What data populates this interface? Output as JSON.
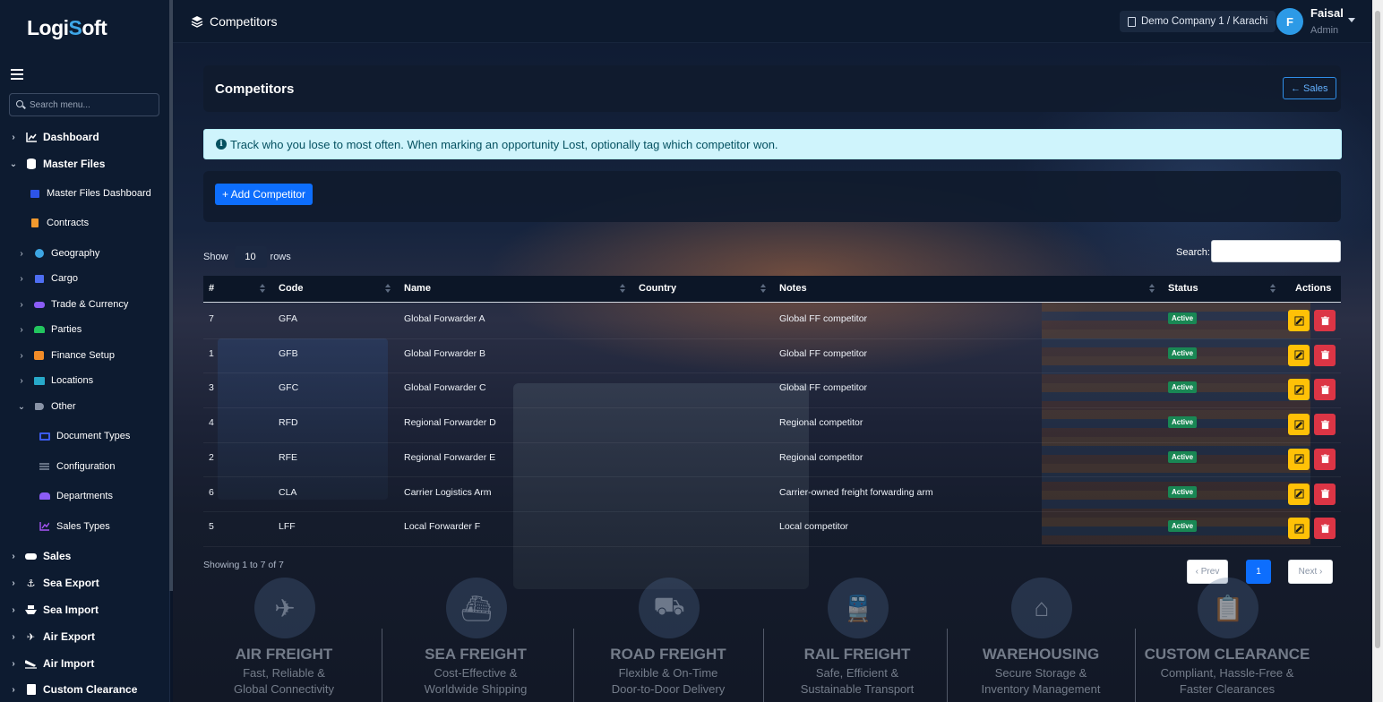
{
  "app": {
    "logo_pre": "Logi",
    "logo_o": "S",
    "logo_post": "oft"
  },
  "sidebar": {
    "search_placeholder": "Search menu...",
    "items": [
      {
        "label": "Dashboard"
      },
      {
        "label": "Master Files"
      },
      {
        "label": "Master Files Dashboard"
      },
      {
        "label": "Contracts"
      },
      {
        "label": "Geography"
      },
      {
        "label": "Cargo"
      },
      {
        "label": "Trade & Currency"
      },
      {
        "label": "Parties"
      },
      {
        "label": "Finance Setup"
      },
      {
        "label": "Locations"
      },
      {
        "label": "Other"
      },
      {
        "label": "Document Types"
      },
      {
        "label": "Configuration"
      },
      {
        "label": "Departments"
      },
      {
        "label": "Sales Types"
      },
      {
        "label": "Sales"
      },
      {
        "label": "Sea Export"
      },
      {
        "label": "Sea Import"
      },
      {
        "label": "Air Export"
      },
      {
        "label": "Air Import"
      },
      {
        "label": "Custom Clearance"
      }
    ]
  },
  "header": {
    "title": "Competitors",
    "company": "Demo Company 1 / Karachi",
    "user_initial": "F",
    "user_name": "Faisal",
    "user_role": "Admin"
  },
  "page": {
    "title": "Competitors",
    "back_label": "Sales",
    "alert": "Track who you lose to most often. When marking an opportunity Lost, optionally tag which competitor won.",
    "add_label": "+ Add Competitor",
    "show_label": "Show",
    "rows_value": "10",
    "rows_label": "rows",
    "search_label": "Search:",
    "search_value": ""
  },
  "table": {
    "columns": [
      "#",
      "Code",
      "Name",
      "Country",
      "Notes",
      "Status",
      "Actions"
    ],
    "rows": [
      {
        "num": "7",
        "code": "GFA",
        "name": "Global Forwarder A",
        "country": "",
        "notes": "Global FF competitor",
        "status": "Active"
      },
      {
        "num": "1",
        "code": "GFB",
        "name": "Global Forwarder B",
        "country": "",
        "notes": "Global FF competitor",
        "status": "Active"
      },
      {
        "num": "3",
        "code": "GFC",
        "name": "Global Forwarder C",
        "country": "",
        "notes": "Global FF competitor",
        "status": "Active"
      },
      {
        "num": "4",
        "code": "RFD",
        "name": "Regional Forwarder D",
        "country": "",
        "notes": "Regional competitor",
        "status": "Active"
      },
      {
        "num": "2",
        "code": "RFE",
        "name": "Regional Forwarder E",
        "country": "",
        "notes": "Regional competitor",
        "status": "Active"
      },
      {
        "num": "6",
        "code": "CLA",
        "name": "Carrier Logistics Arm",
        "country": "",
        "notes": "Carrier-owned freight forwarding arm",
        "status": "Active"
      },
      {
        "num": "5",
        "code": "LFF",
        "name": "Local Forwarder F",
        "country": "",
        "notes": "Local competitor",
        "status": "Active"
      }
    ]
  },
  "pagination": {
    "info": "Showing 1 to 7 of 7",
    "prev": "‹ Prev",
    "current": "1",
    "next": "Next ›"
  },
  "services": [
    {
      "title": "AIR FREIGHT",
      "l1": "Fast, Reliable &",
      "l2": "Global Connectivity",
      "icon": "plane-icon"
    },
    {
      "title": "SEA FREIGHT",
      "l1": "Cost-Effective &",
      "l2": "Worldwide Shipping",
      "icon": "ship-icon"
    },
    {
      "title": "ROAD FREIGHT",
      "l1": "Flexible & On-Time",
      "l2": "Door-to-Door Delivery",
      "icon": "truck-icon"
    },
    {
      "title": "RAIL FREIGHT",
      "l1": "Safe, Efficient &",
      "l2": "Sustainable Transport",
      "icon": "train-icon"
    },
    {
      "title": "WAREHOUSING",
      "l1": "Secure Storage &",
      "l2": "Inventory Management",
      "icon": "warehouse-icon"
    },
    {
      "title": "CUSTOM CLEARANCE",
      "l1": "Compliant, Hassle-Free &",
      "l2": "Faster Clearances",
      "icon": "clipboard-icon"
    }
  ],
  "colors": {
    "primary": "#0d6efd",
    "success": "#198754",
    "warning": "#ffc107",
    "danger": "#dc3545",
    "info_bg": "#cff4fc"
  }
}
